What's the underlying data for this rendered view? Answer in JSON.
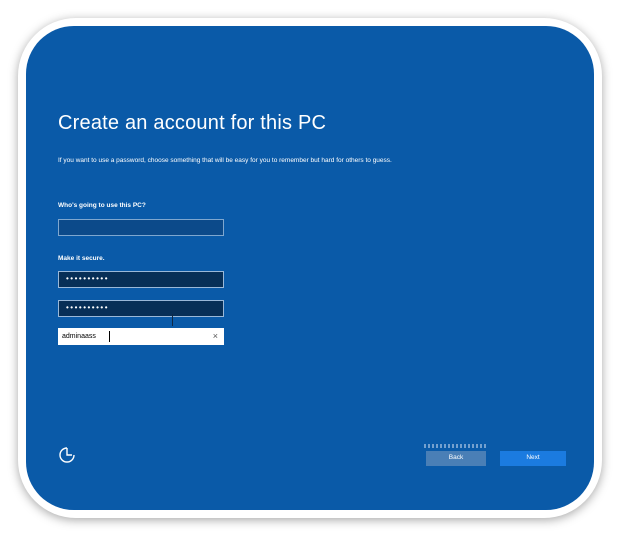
{
  "screen": {
    "title": "Create an account for this PC",
    "description": "If you want to use a password, choose something that will be easy for you to remember but hard for others to guess.",
    "username_label": "Who's going to use this PC?",
    "username_value": "",
    "secure_label": "Make it secure.",
    "password_value": "••••••••••",
    "reenter_value": "••••••••••",
    "hint_value": "adminaass",
    "back_label": "Back",
    "next_label": "Next",
    "accessibility_icon": "accessibility-icon",
    "clear_icon": "×"
  }
}
